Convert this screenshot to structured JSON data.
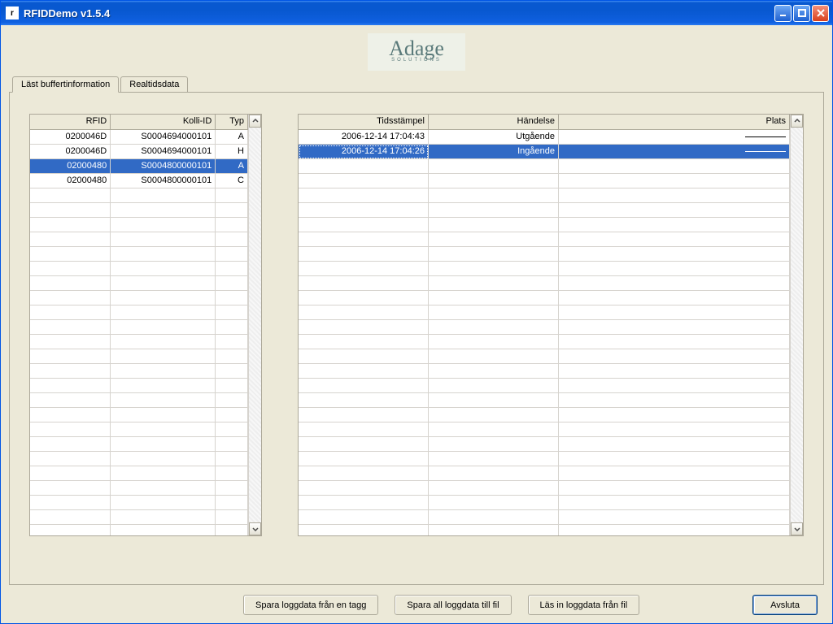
{
  "window": {
    "title": "RFIDDemo v1.5.4"
  },
  "logo": {
    "brand": "Adage",
    "sub": "SOLUTIONS"
  },
  "tabs": [
    {
      "label": "Läst buffertinformation",
      "active": true
    },
    {
      "label": "Realtidsdata",
      "active": false
    }
  ],
  "left_grid": {
    "headers": {
      "rfid": "RFID",
      "kolli": "Kolli-ID",
      "typ": "Typ"
    },
    "rows": [
      {
        "rfid": "0200046D",
        "kolli": "S0004694000101",
        "typ": "A",
        "selected": false
      },
      {
        "rfid": "0200046D",
        "kolli": "S0004694000101",
        "typ": "H",
        "selected": false
      },
      {
        "rfid": "02000480",
        "kolli": "S0004800000101",
        "typ": "A",
        "selected": true
      },
      {
        "rfid": "02000480",
        "kolli": "S0004800000101",
        "typ": "C",
        "selected": false
      }
    ]
  },
  "right_grid": {
    "headers": {
      "ts": "Tidsstämpel",
      "event": "Händelse",
      "plats": "Plats"
    },
    "rows": [
      {
        "ts": "2006-12-14 17:04:43",
        "event": "Utgående",
        "plats": "—",
        "selected": false
      },
      {
        "ts": "2006-12-14 17:04:26",
        "event": "Ingående",
        "plats": "—",
        "selected": true
      }
    ]
  },
  "buttons": {
    "save_one": "Spara loggdata från en tagg",
    "save_all": "Spara all loggdata till fil",
    "load": "Läs in loggdata från fil",
    "quit": "Avsluta"
  }
}
